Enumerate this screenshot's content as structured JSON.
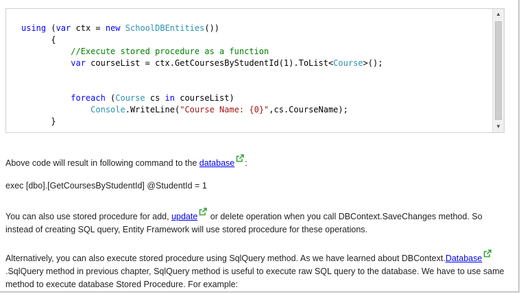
{
  "code": {
    "lines": [
      [
        {
          "t": "using",
          "c": "kw"
        },
        {
          "t": " (",
          "c": ""
        },
        {
          "t": "var",
          "c": "kw"
        },
        {
          "t": " ctx = ",
          "c": ""
        },
        {
          "t": "new",
          "c": "kw"
        },
        {
          "t": " ",
          "c": ""
        },
        {
          "t": "SchoolDBEntities",
          "c": "ty"
        },
        {
          "t": "())",
          "c": ""
        }
      ],
      [
        {
          "t": "      {",
          "c": ""
        }
      ],
      [
        {
          "t": "          //Execute stored procedure as a function",
          "c": "cm"
        }
      ],
      [
        {
          "t": "          ",
          "c": ""
        },
        {
          "t": "var",
          "c": "kw"
        },
        {
          "t": " courseList = ctx.GetCoursesByStudentId(1).ToList<",
          "c": ""
        },
        {
          "t": "Course",
          "c": "ty"
        },
        {
          "t": ">();",
          "c": ""
        }
      ],
      [
        {
          "t": "",
          "c": ""
        }
      ],
      [
        {
          "t": "",
          "c": ""
        }
      ],
      [
        {
          "t": "          ",
          "c": ""
        },
        {
          "t": "foreach",
          "c": "kw"
        },
        {
          "t": " (",
          "c": ""
        },
        {
          "t": "Course",
          "c": "ty"
        },
        {
          "t": " cs ",
          "c": ""
        },
        {
          "t": "in",
          "c": "kw"
        },
        {
          "t": " courseList)",
          "c": ""
        }
      ],
      [
        {
          "t": "              ",
          "c": ""
        },
        {
          "t": "Console",
          "c": "ty"
        },
        {
          "t": ".WriteLine(",
          "c": ""
        },
        {
          "t": "\"Course Name: {0}\"",
          "c": "st"
        },
        {
          "t": ",cs.CourseName);",
          "c": ""
        }
      ],
      [
        {
          "t": "      }",
          "c": ""
        }
      ]
    ]
  },
  "paragraphs": {
    "p1": {
      "before": "Above code will result in following command to the ",
      "link": "database",
      "after": ":"
    },
    "p2": {
      "text": "exec [dbo].[GetCoursesByStudentId] @StudentId = 1"
    },
    "p3": {
      "before": "You can also use stored procedure for add, ",
      "link": "update",
      "after": " or delete operation when you call DBContext.SaveChanges method. So instead of creating SQL query, Entity Framework will use stored procedure for these operations."
    },
    "p4": {
      "before": "Alternatively, you can also execute stored procedure using SqlQuery method. As we have learned about DBContext.",
      "link": "Database",
      "after": ".SqlQuery method in previous chapter, SqlQuery method is useful to execute raw SQL query to the database. We have to use same method to execute database Stored Procedure. For example:"
    }
  },
  "colors": {
    "keyword": "#0000ff",
    "type": "#2b91af",
    "comment": "#008000",
    "string": "#a31515",
    "link": "#0000ee",
    "ext_icon": "#3aa63a"
  },
  "icons": {
    "scroll_up": "▲",
    "scroll_down": "▼",
    "external_link": "external-link-icon"
  }
}
